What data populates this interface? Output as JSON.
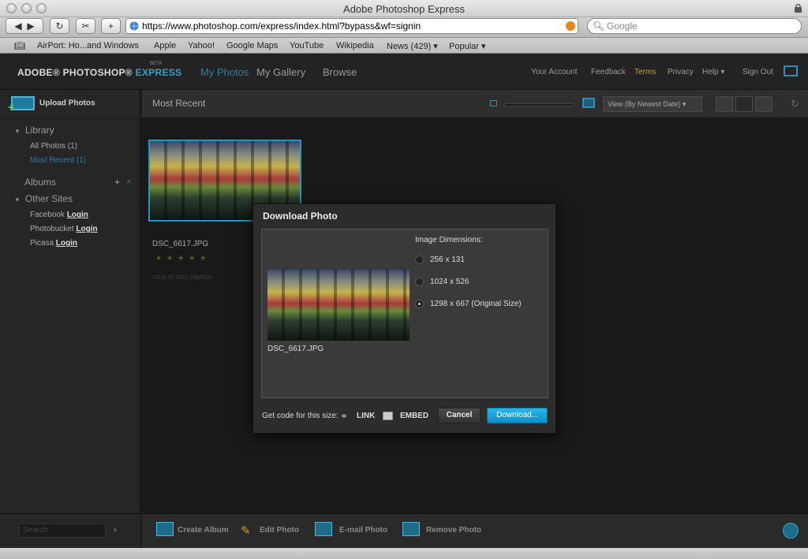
{
  "browser": {
    "window_title": "Adobe Photoshop Express",
    "url": "https://www.photoshop.com/express/index.html?bypass&wf=signin",
    "search_placeholder": "Google",
    "new_tab_label": "+",
    "bookmarks": [
      "AirPort: Ho...and Windows",
      "Apple",
      "Yahoo!",
      "Google Maps",
      "YouTube",
      "Wikipedia",
      "News (429) ▾",
      "Popular ▾"
    ]
  },
  "app": {
    "logo": "ADOBE® PHOTOSHOP®",
    "logo_express": "EXPRESS",
    "beta": "BETA",
    "nav": [
      "My Photos",
      "My Gallery",
      "Browse"
    ],
    "top_links": [
      "Your Account",
      "Feedback",
      "Terms",
      "Privacy",
      "Help ▾",
      "Sign Out"
    ],
    "accent": "#2b7fa3"
  },
  "sidebar": {
    "upload_label": "Upload Photos",
    "library": "Library",
    "library_items": [
      "All Photos (1)",
      "Most Recent (1)"
    ],
    "albums": "Albums",
    "other_sites": "Other Sites",
    "sites": [
      {
        "name": "Facebook",
        "action": "Login"
      },
      {
        "name": "Photobucket",
        "action": "Login"
      },
      {
        "name": "Picasa",
        "action": "Login"
      }
    ],
    "search_placeholder": "Search"
  },
  "main": {
    "title": "Most Recent",
    "view_select": "View (By Newest Date) ▾",
    "photo": {
      "filename": "DSC_6617.JPG",
      "stars": "★★★★★",
      "caption_placeholder": "click to add caption"
    }
  },
  "bottom": {
    "actions": [
      "Create Album",
      "Edit Photo",
      "E-mail Photo",
      "Remove Photo"
    ]
  },
  "dialog": {
    "title": "Download Photo",
    "filename": "DSC_6617.JPG",
    "dimensions_label": "Image Dimensions:",
    "sizes": [
      "256 x 131",
      "1024 x 526",
      "1298 x 667 (Original Size)"
    ],
    "selected_size_index": 2,
    "get_code_label": "Get code for this size:",
    "link_label": "LINK",
    "embed_label": "EMBED",
    "cancel_label": "Cancel",
    "download_label": "Download..."
  }
}
